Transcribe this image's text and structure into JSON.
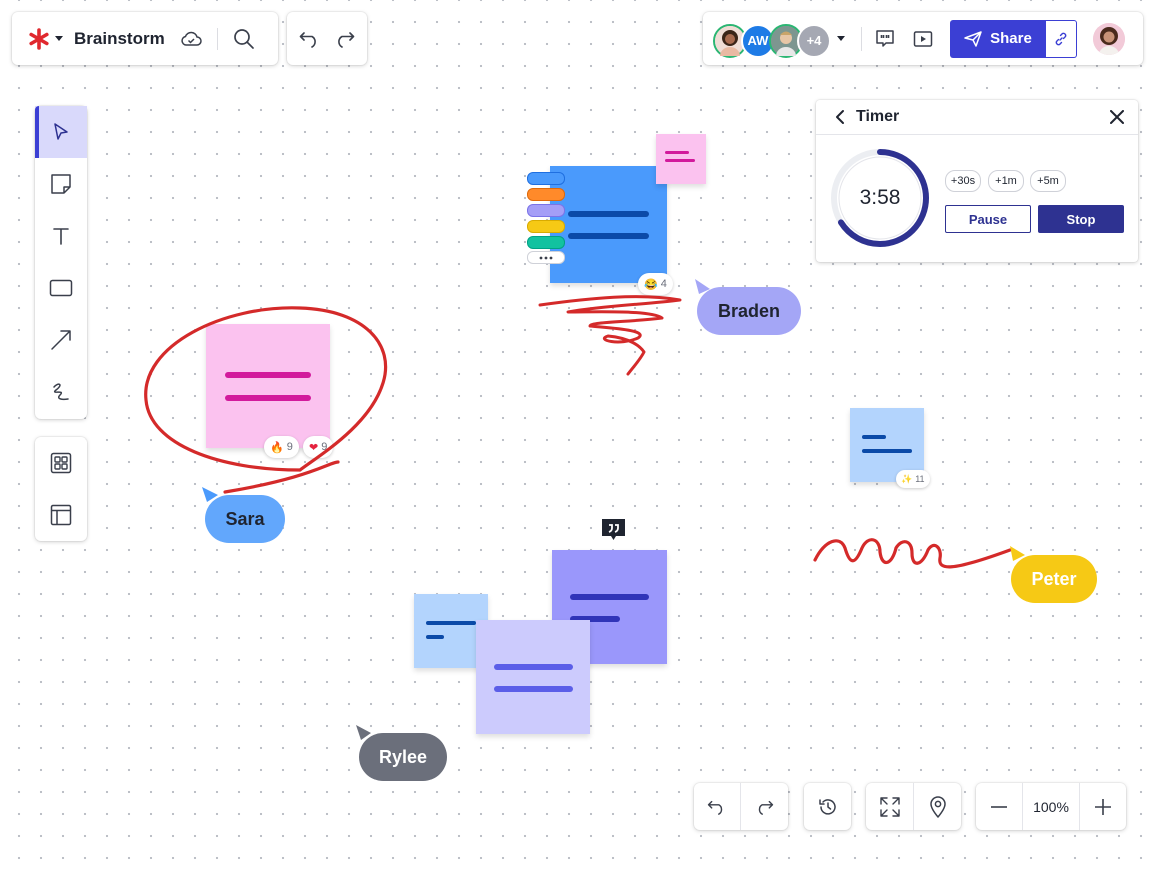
{
  "app": {
    "board_title": "Brainstorm"
  },
  "collaborators": {
    "avatars": [
      {
        "name": "avatar-user-1",
        "initials": "",
        "color": "#2bb673"
      },
      {
        "name": "avatar-aw",
        "initials": "AW",
        "color": "#1e7be6"
      },
      {
        "name": "avatar-user-3",
        "initials": "",
        "color": "#2bb673"
      },
      {
        "name": "avatar-more",
        "initials": "+4",
        "color": "#a5a8b3"
      }
    ],
    "share_label": "Share"
  },
  "timer": {
    "title": "Timer",
    "time": "3:58",
    "progress": 0.66,
    "add_options": [
      "+30s",
      "+1m",
      "+5m"
    ],
    "pause_label": "Pause",
    "stop_label": "Stop"
  },
  "cursors": {
    "braden": "Braden",
    "sara": "Sara",
    "peter": "Peter",
    "rylee": "Rylee"
  },
  "reactions": {
    "laugh": {
      "emoji": "😂",
      "count": "4"
    },
    "fire": {
      "emoji": "🔥",
      "count": "9"
    },
    "heart": {
      "emoji": "❤",
      "count": "9"
    },
    "sparkle": {
      "emoji": "✨",
      "count": "11"
    }
  },
  "zoom": {
    "level": "100%"
  },
  "colors": {
    "accent": "#3b3fd4",
    "timer_dark": "#2e3291",
    "marker_red": "#d42a2a",
    "sticky_blue": "#4a9afc",
    "sticky_pink": "#fbc2ef",
    "sticky_light_blue": "#b3d4fd",
    "sticky_violet": "#9a97fb",
    "sticky_lavender": "#cccbfd"
  },
  "icons": {
    "logo": "asterisk-logo-icon",
    "cloud": "cloud-saved-icon",
    "search": "search-icon",
    "undo": "undo-icon",
    "redo": "redo-icon",
    "select": "cursor-arrow-icon",
    "sticky": "sticky-note-icon",
    "text": "text-icon",
    "shape": "rectangle-icon",
    "arrow": "arrow-line-icon",
    "pen": "pen-scribble-icon",
    "templates": "templates-grid-icon",
    "layout": "layout-panel-icon",
    "comment": "comment-quote-icon",
    "present": "present-play-icon",
    "history": "history-icon",
    "fit": "fit-screen-icon",
    "location": "location-pin-icon",
    "zoom_out": "minus-icon",
    "zoom_in": "plus-icon"
  }
}
